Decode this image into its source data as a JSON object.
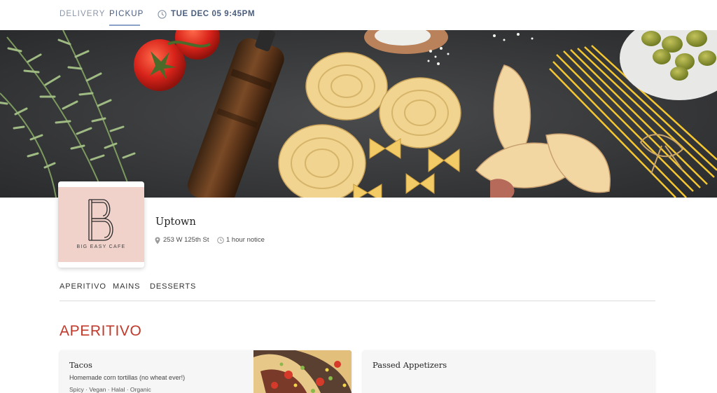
{
  "nav": {
    "delivery_label": "DELIVERY",
    "pickup_label": "PICKUP",
    "selected_tab": "PICKUP",
    "datetime": "TUE DEC 05 9:45PM"
  },
  "logo": {
    "letter": "B",
    "text": "BIG EASY CAFE"
  },
  "location": {
    "name": "Uptown",
    "address": "253 W 125th St",
    "notice": "1 hour notice"
  },
  "menu_tabs": [
    "APERITIVO",
    "MAINS",
    "DESSERTS"
  ],
  "section": {
    "title": "APERITIVO",
    "items": [
      {
        "title": "Tacos",
        "description": "Homemade corn tortillas (no wheat ever!)",
        "tags": "Spicy · Vegan · Halal · Organic"
      },
      {
        "title": "Passed Appetizers"
      }
    ]
  },
  "colors": {
    "accent": "#c0392b",
    "nav_active": "#4a5d7e",
    "nav_inactive": "#8a96a6",
    "logo_bg": "#f1d2cb"
  }
}
